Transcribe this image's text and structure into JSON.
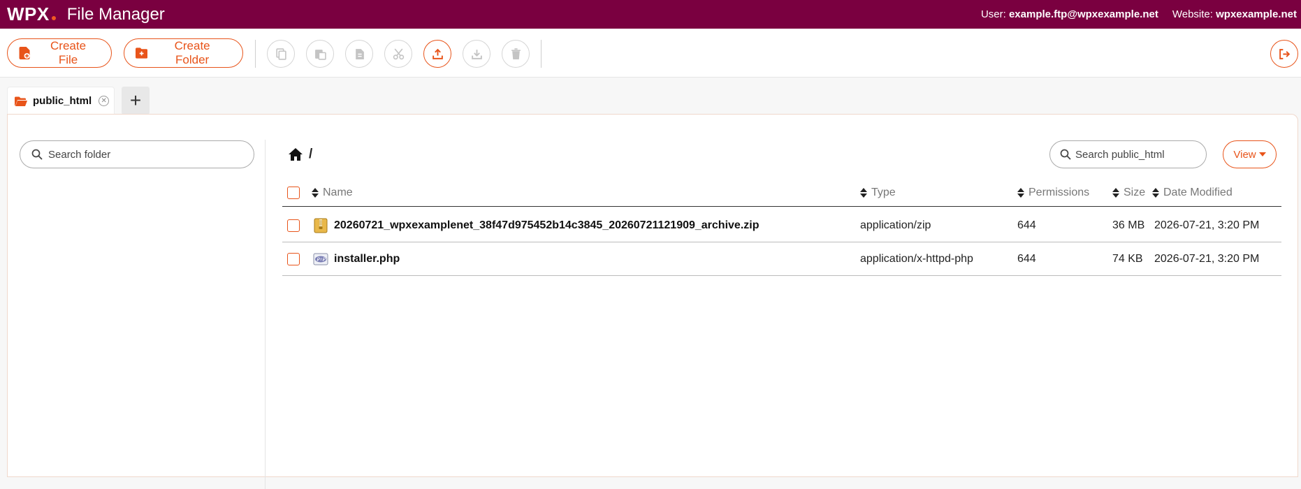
{
  "header": {
    "logo": "WPX",
    "title": "File Manager",
    "user_label": "User:",
    "user_value": "example.ftp@wpxexample.net",
    "website_label": "Website:",
    "website_value": "wpxexample.net",
    "colors": {
      "brand": "#7a0040",
      "accent": "#e8541a"
    }
  },
  "toolbar": {
    "create_file": "Create File",
    "create_folder": "Create Folder",
    "icons": [
      "copy-icon",
      "paste-icon",
      "rename-icon",
      "cut-icon",
      "upload-icon",
      "download-icon",
      "delete-icon",
      "logout-icon"
    ]
  },
  "tabs": [
    {
      "label": "public_html"
    }
  ],
  "sidebar": {
    "search_placeholder": "Search folder"
  },
  "main": {
    "breadcrumb": "/",
    "search_placeholder": "Search public_html",
    "view_label": "View"
  },
  "table": {
    "columns": [
      "Name",
      "Type",
      "Permissions",
      "Size",
      "Date Modified"
    ],
    "rows": [
      {
        "name": "20260721_wpxexamplenet_38f47d975452b14c3845_20260721121909_archive.zip",
        "type": "application/zip",
        "permissions": "644",
        "size": "36 MB",
        "modified": "2026-07-21, 3:20 PM",
        "icon": "zip-file-icon"
      },
      {
        "name": "installer.php",
        "type": "application/x-httpd-php",
        "permissions": "644",
        "size": "74 KB",
        "modified": "2026-07-21, 3:20 PM",
        "icon": "php-file-icon"
      }
    ]
  }
}
